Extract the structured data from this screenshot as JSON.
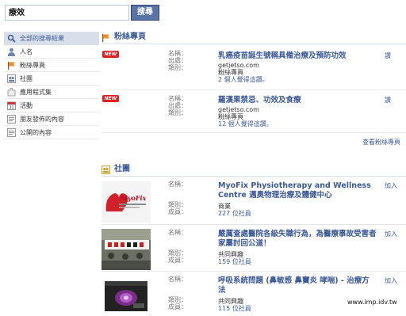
{
  "search": {
    "value": "療效",
    "button_label": "搜尋"
  },
  "sidebar": {
    "items": [
      {
        "label": "全部的搜尋結果",
        "icon": "search-icon"
      },
      {
        "label": "人名",
        "icon": "person-icon"
      },
      {
        "label": "粉絲專頁",
        "icon": "flag-icon"
      },
      {
        "label": "社團",
        "icon": "group-icon"
      },
      {
        "label": "應用程式集",
        "icon": "puzzle-icon"
      },
      {
        "label": "活動",
        "icon": "calendar-icon"
      },
      {
        "label": "朋友發佈的內容",
        "icon": "post-icon"
      },
      {
        "label": "公開的內容",
        "icon": "post-icon"
      }
    ]
  },
  "pages_section": {
    "heading": "粉絲專頁",
    "see_more": "查看粉絲專頁",
    "field_labels": [
      "名稱：",
      "出處：",
      "類別："
    ],
    "results": [
      {
        "badge": "NEW",
        "title": "乳癌疫苗誕生號稱具備治療及預防功效",
        "source": "getjetso.com",
        "category": "粉絲專頁",
        "likes": "2 個人覺得這讚。",
        "action": "讚"
      },
      {
        "badge": "NEW",
        "title": "羅漢果禁忌、功效及食療",
        "source": "getjetso.com",
        "category": "粉絲專頁",
        "likes": "12 個人覺得這讚。",
        "action": "讚"
      }
    ]
  },
  "groups_section": {
    "heading": "社團",
    "field_labels": [
      "名稱：",
      "類別：",
      "成員："
    ],
    "results": [
      {
        "title": "MyoFix Physiotherapy and Wellness Centre 邁奧物理治療及體健中心",
        "category": "商業",
        "members": "227 位社員",
        "action": "加入",
        "thumb_text": "MyoFix"
      },
      {
        "title": "嚴厲查處醫院各級失職行為，為醫療事故受害者家屬討回公道！",
        "category": "共同興趣",
        "members": "159 位社員",
        "action": "加入",
        "thumb_text": ""
      },
      {
        "title": "呼吸系統問題 (鼻敏感 鼻竇炎 哮喘) - 治療方法",
        "category": "共同興趣",
        "members": "115 位社員",
        "action": "加入",
        "thumb_text": ""
      }
    ]
  },
  "watermark": "www.imp.idv.tw"
}
